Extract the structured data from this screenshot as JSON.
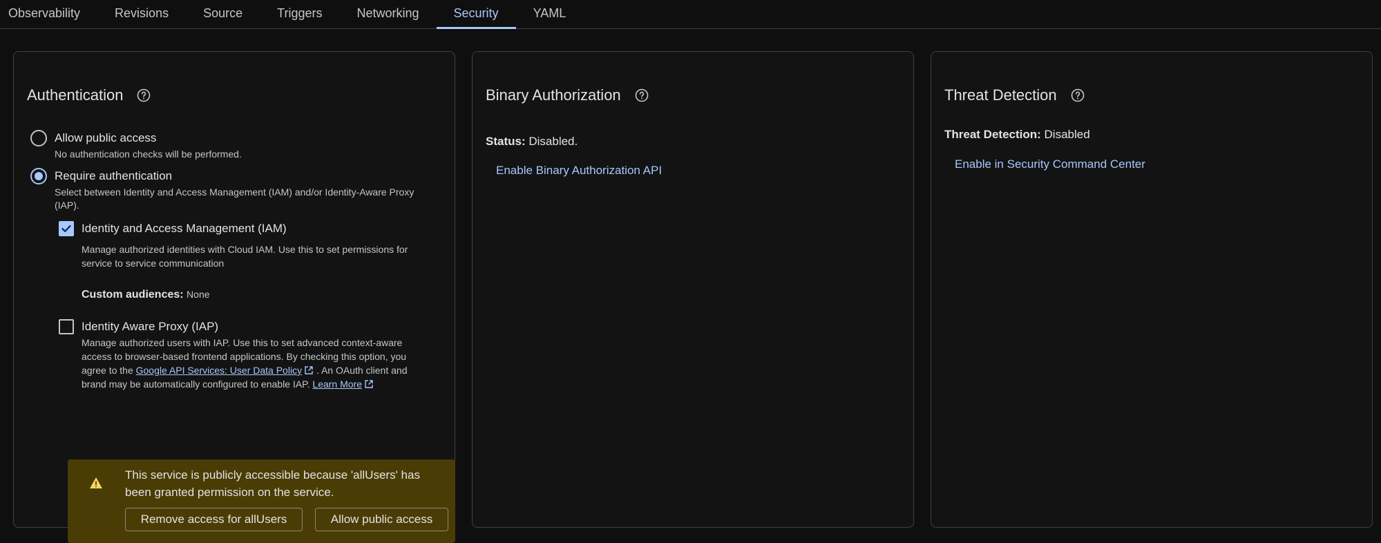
{
  "tabs": [
    {
      "label": "Observability"
    },
    {
      "label": "Revisions"
    },
    {
      "label": "Source"
    },
    {
      "label": "Triggers"
    },
    {
      "label": "Networking"
    },
    {
      "label": "Security",
      "active": true
    },
    {
      "label": "YAML"
    }
  ],
  "auth": {
    "title": "Authentication",
    "allow_public": {
      "label": "Allow public access",
      "desc": "No authentication checks will be performed.",
      "selected": false
    },
    "require_auth": {
      "label": "Require authentication",
      "desc1": "Select between Identity and Access Management (IAM) and/or Identity-Aware Proxy",
      "desc2": "(IAP).",
      "selected": true
    },
    "iam": {
      "label": "Identity and Access Management (IAM)",
      "desc1": "Manage authorized identities with Cloud IAM. Use this to set permissions for",
      "desc2": "service to service communication",
      "checked": true
    },
    "custom_audiences": {
      "label": "Custom audiences:",
      "value": "None"
    },
    "iap": {
      "label": "Identity Aware Proxy (IAP)",
      "desc1": "Manage authorized users with IAP. Use this to set advanced context-aware",
      "desc2": "access to browser-based frontend applications. By checking this option, you",
      "desc3_pre": "agree to the",
      "policy_link": "Google API Services: User Data Policy",
      "desc3_post": ". An OAuth client and",
      "desc4_pre": "brand may be automatically configured to enable IAP.",
      "learn_more": "Learn More",
      "checked": false
    },
    "warning": {
      "text1": "This service is publicly accessible because 'allUsers' has",
      "text2": "been granted permission on the service.",
      "remove_button": "Remove access for allUsers",
      "allow_button": "Allow public access"
    }
  },
  "binary_auth": {
    "title": "Binary Authorization",
    "status_label": "Status:",
    "status_value": "Disabled.",
    "enable_link": "Enable Binary Authorization API"
  },
  "threat": {
    "title": "Threat Detection",
    "status_label": "Threat Detection:",
    "status_value": "Disabled",
    "enable_link": "Enable in Security Command Center"
  },
  "colors": {
    "accent": "#a8c7fa",
    "background": "#0f0f0f",
    "panel": "#131314",
    "warning_bg": "#4a3c05",
    "warning_icon": "#fdd663"
  },
  "icons": [
    "help-icon",
    "check-icon",
    "warning-icon",
    "external-link-icon"
  ]
}
